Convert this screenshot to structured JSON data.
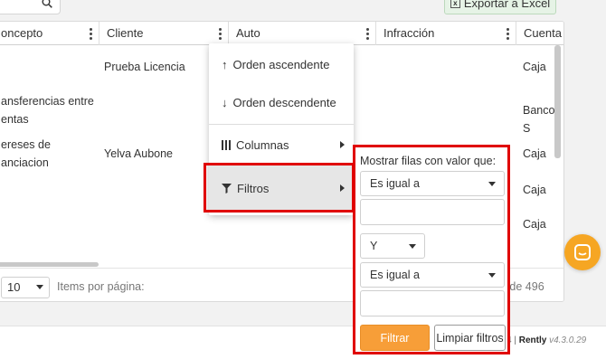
{
  "toolbar": {
    "export_label": "Exportar a Excel"
  },
  "table": {
    "headers": [
      "oncepto",
      "Cliente",
      "Auto",
      "Infracción",
      "Cuenta"
    ],
    "rows": [
      {
        "concepto": "",
        "cliente": "Prueba Licencia",
        "cuenta": "Caja"
      },
      {
        "concepto": "ansferencias entre\nentas",
        "cliente": "",
        "cuenta": "Banco S"
      },
      {
        "concepto": "ereses de\nanciacion",
        "cliente": "Yelva Aubone",
        "cuenta": "Caja"
      },
      {
        "concepto": "",
        "cliente": "",
        "cuenta": "Caja"
      },
      {
        "concepto": "",
        "cliente": "",
        "cuenta": "Caja"
      }
    ]
  },
  "pagination": {
    "per_page": "10",
    "per_page_label": "Items por página:",
    "range_text": "0 de 496"
  },
  "column_menu": {
    "items": [
      {
        "label": "Orden ascendente",
        "icon": "arrow-up-icon"
      },
      {
        "label": "Orden descendente",
        "icon": "arrow-down-icon"
      },
      {
        "label": "Columnas",
        "icon": "columns-icon"
      },
      {
        "label": "Filtros",
        "icon": "filter-icon"
      }
    ]
  },
  "filter_panel": {
    "title": "Mostrar filas con valor que:",
    "condition1": "Es igual a",
    "value1": "",
    "operator": "Y",
    "condition2": "Es igual a",
    "value2": "",
    "apply_label": "Filtrar",
    "clear_label": "Limpiar filtros"
  },
  "footer": {
    "prefix": "4 |",
    "brand": "Rently",
    "version": "v4.3.0.29"
  },
  "colors": {
    "accent": "#f79e38",
    "highlight": "#e00000",
    "chat": "#f6a623"
  }
}
